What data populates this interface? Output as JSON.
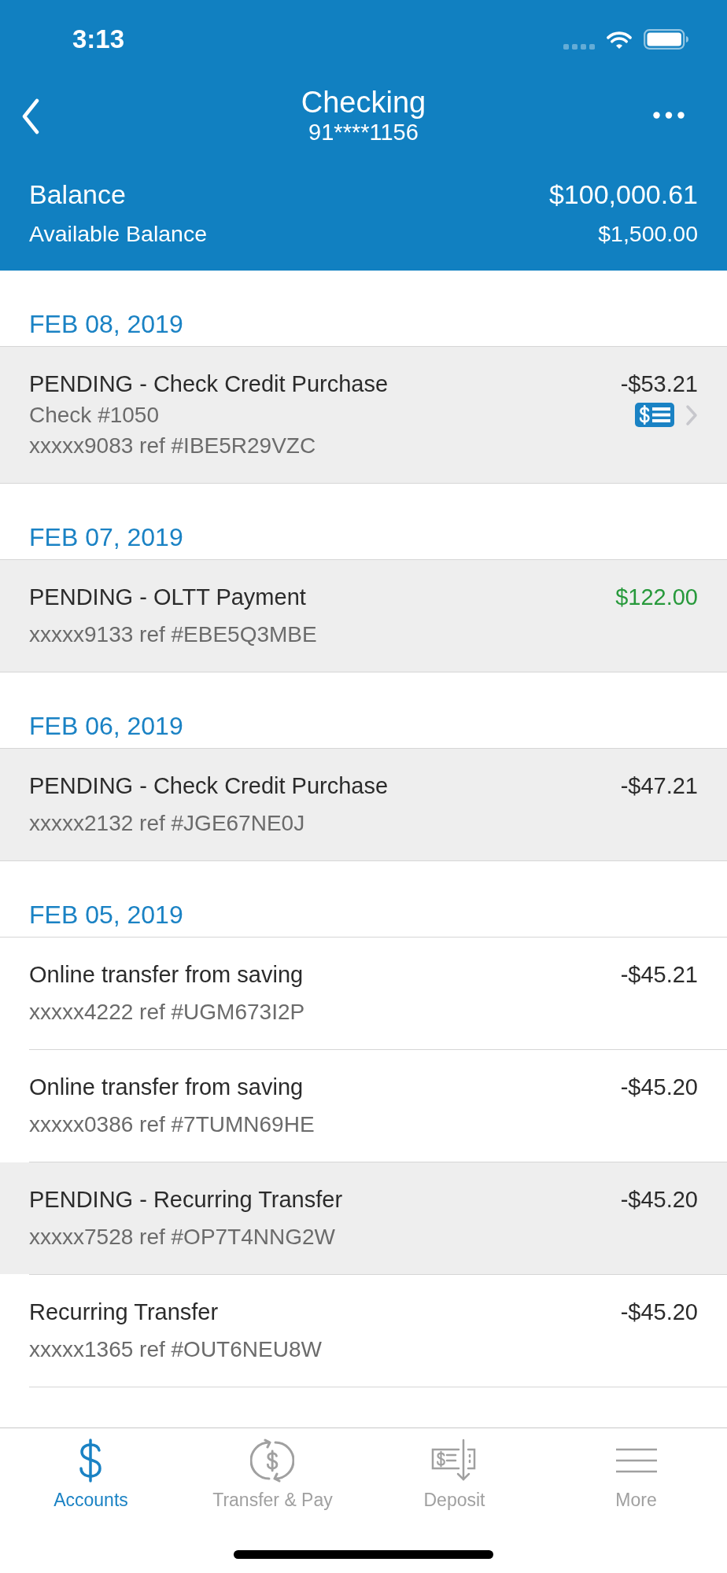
{
  "status_bar": {
    "time": "3:13"
  },
  "nav": {
    "title": "Checking",
    "subtitle": "91****1156"
  },
  "balances": [
    {
      "kind": "primary",
      "label": "Balance",
      "amount": "$100,000.61"
    },
    {
      "kind": "secondary",
      "label": "Available Balance",
      "amount": "$1,500.00"
    }
  ],
  "groups": [
    {
      "date": "FEB 08, 2019",
      "transactions": [
        {
          "description": "PENDING - Check Credit Purchase",
          "details": [
            "Check #1050",
            "xxxxx9083 ref #IBE5R29VZC"
          ],
          "amount": "-$53.21",
          "kind": "debit",
          "pending": true,
          "check_image": true
        }
      ]
    },
    {
      "date": "FEB 07, 2019",
      "transactions": [
        {
          "description": "PENDING - OLTT Payment",
          "details": [
            "xxxxx9133 ref #EBE5Q3MBE"
          ],
          "amount": "$122.00",
          "kind": "credit",
          "pending": true,
          "check_image": false
        }
      ]
    },
    {
      "date": "FEB 06, 2019",
      "transactions": [
        {
          "description": "PENDING - Check Credit Purchase",
          "details": [
            "xxxxx2132 ref #JGE67NE0J"
          ],
          "amount": "-$47.21",
          "kind": "debit",
          "pending": true,
          "check_image": false
        }
      ]
    },
    {
      "date": "FEB 05, 2019",
      "transactions": [
        {
          "description": "Online transfer from saving",
          "details": [
            "xxxxx4222 ref #UGM673I2P"
          ],
          "amount": "-$45.21",
          "kind": "debit",
          "pending": false,
          "check_image": false
        },
        {
          "description": "Online transfer from saving",
          "details": [
            "xxxxx0386 ref #7TUMN69HE"
          ],
          "amount": "-$45.20",
          "kind": "debit",
          "pending": false,
          "check_image": false
        },
        {
          "description": "PENDING - Recurring Transfer",
          "details": [
            "xxxxx7528 ref #OP7T4NNG2W"
          ],
          "amount": "-$45.20",
          "kind": "debit",
          "pending": true,
          "check_image": false
        },
        {
          "description": "Recurring Transfer",
          "details": [
            "xxxxx1365 ref #OUT6NEU8W"
          ],
          "amount": "-$45.20",
          "kind": "debit",
          "pending": false,
          "check_image": false
        }
      ]
    }
  ],
  "tab_bar": [
    {
      "label": "Accounts",
      "kind": "dollar",
      "selected": true
    },
    {
      "label": "Transfer & Pay",
      "kind": "exchange",
      "selected": false
    },
    {
      "label": "Deposit",
      "kind": "deposit",
      "selected": false
    },
    {
      "label": "More",
      "kind": "menu",
      "selected": false
    }
  ]
}
